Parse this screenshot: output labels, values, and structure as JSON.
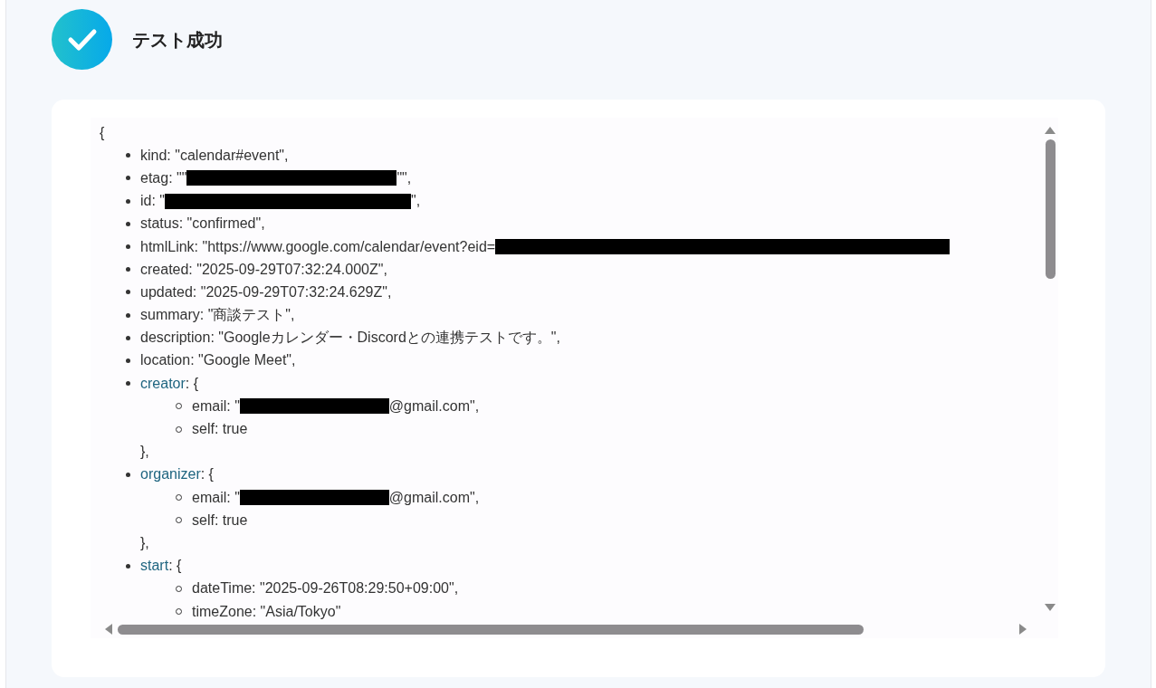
{
  "header": {
    "title": "テスト成功"
  },
  "result": {
    "open": "{",
    "items": [
      {
        "kind": "value",
        "segments": [
          {
            "kind": "text",
            "text": "kind: \"calendar#event\","
          }
        ]
      },
      {
        "kind": "value",
        "segments": [
          {
            "kind": "text",
            "text": "etag: \"\""
          },
          {
            "kind": "redaction"
          },
          {
            "kind": "text",
            "text": "\"\","
          }
        ]
      },
      {
        "kind": "value",
        "segments": [
          {
            "kind": "text",
            "text": "id: \""
          },
          {
            "kind": "redaction"
          },
          {
            "kind": "text",
            "text": "\","
          }
        ]
      },
      {
        "kind": "value",
        "segments": [
          {
            "kind": "text",
            "text": "status: \"confirmed\","
          }
        ]
      },
      {
        "kind": "value",
        "segments": [
          {
            "kind": "text",
            "text": "htmlLink: \"https://www.google.com/calendar/event?eid="
          },
          {
            "kind": "redaction"
          }
        ]
      },
      {
        "kind": "value",
        "segments": [
          {
            "kind": "text",
            "text": "created: \"2025-09-29T07:32:24.000Z\","
          }
        ]
      },
      {
        "kind": "value",
        "segments": [
          {
            "kind": "text",
            "text": "updated: \"2025-09-29T07:32:24.629Z\","
          }
        ]
      },
      {
        "kind": "value",
        "segments": [
          {
            "kind": "text",
            "text": "summary: \"商談テスト\","
          }
        ]
      },
      {
        "kind": "value",
        "segments": [
          {
            "kind": "text",
            "text": "description: \"Googleカレンダー・Discordとの連携テストです。\","
          }
        ]
      },
      {
        "kind": "value",
        "segments": [
          {
            "kind": "text",
            "text": "location: \"Google Meet\","
          }
        ]
      },
      {
        "kind": "object",
        "key": "creator",
        "open": ": {",
        "close": "},",
        "children": [
          {
            "kind": "value",
            "segments": [
              {
                "kind": "text",
                "text": "email: \""
              },
              {
                "kind": "redaction"
              },
              {
                "kind": "text",
                "text": "@gmail.com\","
              }
            ]
          },
          {
            "kind": "value",
            "segments": [
              {
                "kind": "text",
                "text": "self: true"
              }
            ]
          }
        ]
      },
      {
        "kind": "object",
        "key": "organizer",
        "open": ": {",
        "close": "},",
        "children": [
          {
            "kind": "value",
            "segments": [
              {
                "kind": "text",
                "text": "email: \""
              },
              {
                "kind": "redaction"
              },
              {
                "kind": "text",
                "text": "@gmail.com\","
              }
            ]
          },
          {
            "kind": "value",
            "segments": [
              {
                "kind": "text",
                "text": "self: true"
              }
            ]
          }
        ]
      },
      {
        "kind": "object",
        "key": "start",
        "open": ": {",
        "children": [
          {
            "kind": "value",
            "segments": [
              {
                "kind": "text",
                "text": "dateTime: \"2025-09-26T08:29:50+09:00\","
              }
            ]
          },
          {
            "kind": "value",
            "segments": [
              {
                "kind": "text",
                "text": "timeZone: \"Asia/Tokyo\""
              }
            ]
          }
        ]
      }
    ]
  }
}
